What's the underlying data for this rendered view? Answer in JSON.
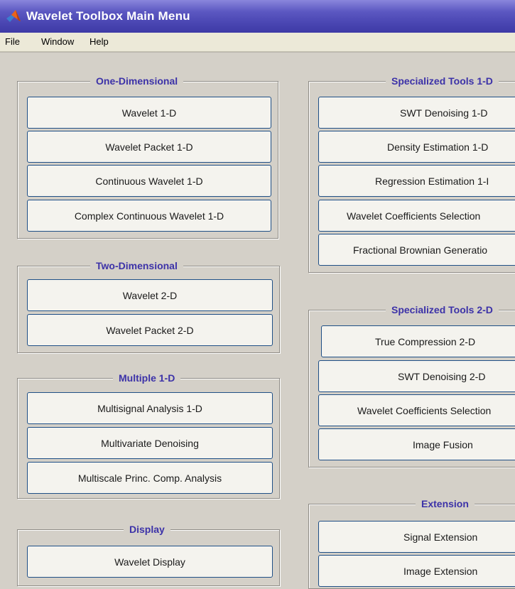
{
  "window": {
    "title": "Wavelet Toolbox Main Menu"
  },
  "menu": [
    "File",
    "Window",
    "Help"
  ],
  "panels": {
    "one_d": {
      "title": "One-Dimensional",
      "buttons": [
        "Wavelet 1-D",
        "Wavelet Packet 1-D",
        "Continuous Wavelet 1-D",
        "Complex Continuous Wavelet 1-D"
      ]
    },
    "two_d": {
      "title": "Two-Dimensional",
      "buttons": [
        "Wavelet 2-D",
        "Wavelet Packet 2-D"
      ]
    },
    "multiple_1d": {
      "title": "Multiple 1-D",
      "buttons": [
        "Multisignal Analysis 1-D",
        "Multivariate Denoising",
        "Multiscale Princ. Comp. Analysis"
      ]
    },
    "display": {
      "title": "Display",
      "buttons": [
        "Wavelet Display"
      ]
    },
    "spec_1d": {
      "title": "Specialized Tools 1-D",
      "buttons": [
        "SWT Denoising 1-D",
        "Density Estimation 1-D",
        "Regression Estimation 1-I",
        "Wavelet Coefficients Selection",
        "Fractional Brownian Generatio"
      ]
    },
    "spec_2d": {
      "title": "Specialized Tools 2-D",
      "buttons": [
        "True Compression 2-D",
        "SWT Denoising 2-D",
        "Wavelet Coefficients Selection",
        "Image Fusion"
      ]
    },
    "extension": {
      "title": "Extension",
      "buttons": [
        "Signal Extension",
        "Image Extension"
      ]
    }
  },
  "colors": {
    "titlebar": "#4a46b2",
    "panel_title": "#3c32a8",
    "button_border": "#1f4f86",
    "background": "#d4d0c8"
  },
  "icons": {
    "app": "matlab-logo-icon"
  }
}
